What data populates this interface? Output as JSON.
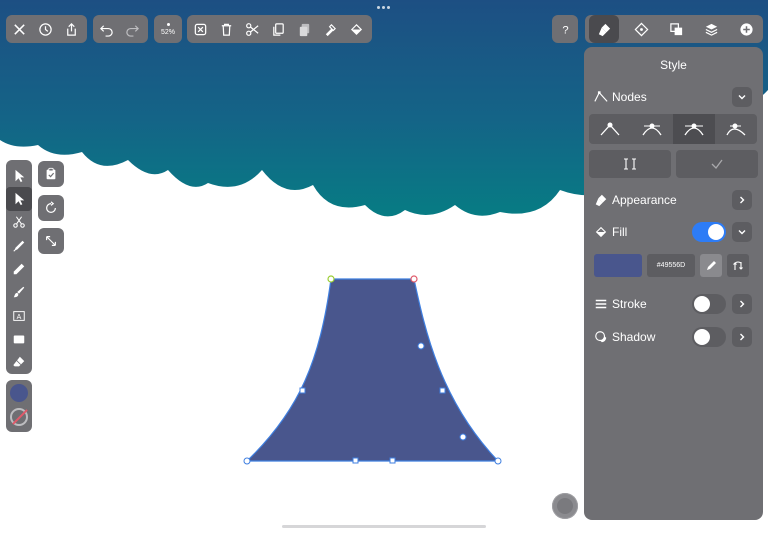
{
  "toolbar": {
    "zoom": "52%",
    "left_icons": [
      "close-icon",
      "history-icon",
      "share-icon"
    ],
    "history_icons": [
      "undo-icon",
      "redo-icon"
    ],
    "edit_icons": [
      "deselect-icon",
      "trash-icon",
      "scissors-icon",
      "copy-icon",
      "paste-icon",
      "duplicate-style-icon",
      "clear-fill-icon"
    ],
    "right_icons": [
      "help-icon",
      "style-brush-icon",
      "nodes-diamond-icon",
      "boolean-icon",
      "layers-icon",
      "add-icon"
    ]
  },
  "left_tools": [
    "select-arrow",
    "node-arrow",
    "scissors",
    "pen",
    "pencil",
    "brush",
    "text",
    "rectangle",
    "eraser"
  ],
  "colors": {
    "fill": "#49568D",
    "stroke_none": "no-stroke-swatch",
    "accent": "#2d7cf6",
    "panel": "#6f6f73",
    "cloud_top": "#1b5a86",
    "cloud_bottom": "#0b7a85"
  },
  "panel": {
    "title": "Style",
    "nodes": {
      "label": "Nodes"
    },
    "node_types": [
      "sharp-node",
      "smooth-node",
      "symmetric-node",
      "asymmetric-node"
    ],
    "node_actions": [
      "break-node",
      "confirm-node"
    ],
    "appearance": {
      "label": "Appearance"
    },
    "fill": {
      "label": "Fill",
      "enabled": true,
      "hex": "#49556D"
    },
    "stroke": {
      "label": "Stroke",
      "enabled": false
    },
    "shadow": {
      "label": "Shadow",
      "enabled": false
    }
  }
}
